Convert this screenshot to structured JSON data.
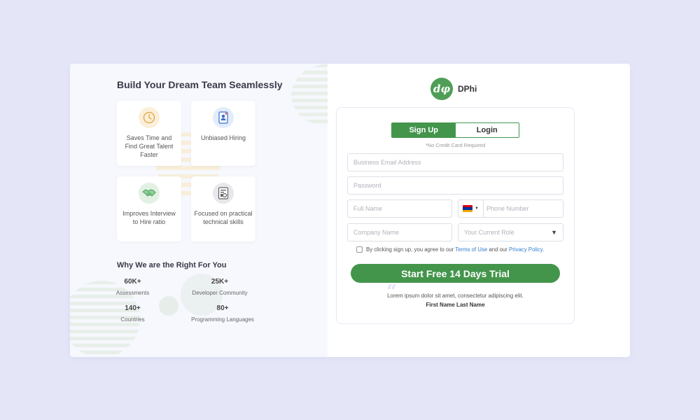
{
  "left": {
    "title": "Build Your Dream Team Seamlessly",
    "features": [
      {
        "label": "Saves Time and Find Great Talent Faster",
        "icon": "clock-icon"
      },
      {
        "label": "Unbiased Hiring",
        "icon": "profile-card-icon"
      },
      {
        "label": "Improves Interview to Hire ratio",
        "icon": "handshake-icon"
      },
      {
        "label": "Focused on practical technical skills",
        "icon": "skills-screen-icon"
      }
    ],
    "why_title": "Why We are the Right For You",
    "stats": [
      {
        "value": "60K+",
        "label": "Assessments"
      },
      {
        "value": "25K+",
        "label": "Developer Community"
      },
      {
        "value": "140+",
        "label": "Countries"
      },
      {
        "value": "80+",
        "label": "Programming Languages"
      }
    ]
  },
  "brand": {
    "logo_text": "dφ",
    "name": "DPhi",
    "color": "#4e9e57"
  },
  "form": {
    "tabs": [
      {
        "label": "Sign Up",
        "active": true
      },
      {
        "label": "Login",
        "active": false
      }
    ],
    "no_credit_card": "*No Credit Card  Required",
    "fields": {
      "email_placeholder": "Business Email Address",
      "password_placeholder": "Password",
      "fullname_placeholder": "Full Name",
      "phone_placeholder": "Phone Number",
      "company_placeholder": "Company Name",
      "role_placeholder": "Your Current Role"
    },
    "terms": {
      "prefix": "By clicking sign up, you agree to our",
      "terms_link": "Terms of Use",
      "middle": "and our",
      "privacy_link": "Privacy Policy",
      "suffix": "."
    },
    "cta_label": "Start Free 14 Days Trial",
    "accent_color": "#43954b"
  },
  "testimonial": {
    "quote_mark": "“",
    "text": "Lorem ipsum dolor sit amet, consectetur adipiscing elit.",
    "author": "First Name Last Name"
  }
}
